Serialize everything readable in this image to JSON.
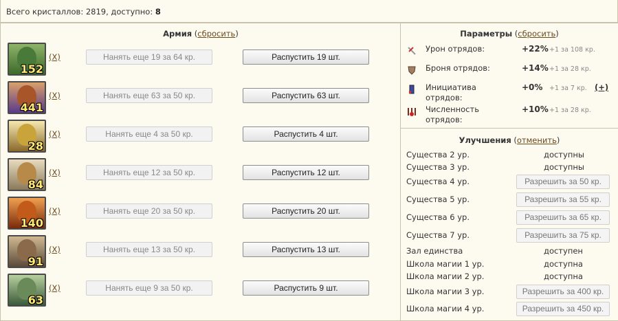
{
  "header": {
    "crystals_label": "Всего кристаллов: 2819, доступно:",
    "available": "8"
  },
  "army": {
    "title": "Армия",
    "reset_open": " (",
    "reset_label": "сбросить",
    "reset_close": ")",
    "units": [
      {
        "count": "152",
        "x": "(X)",
        "hire": "Нанять еще 19 за 64 кр.",
        "dismiss": "Распустить 19 шт.",
        "color": "#4a7a3a"
      },
      {
        "count": "441",
        "x": "(X)",
        "hire": "Нанять еще 63 за 50 кр.",
        "dismiss": "Распустить 63 шт.",
        "color": "#a8552a"
      },
      {
        "count": "28",
        "x": "(X)",
        "hire": "Нанять еще 4 за 50 кр.",
        "dismiss": "Распустить 4 шт.",
        "color": "#c9a43a"
      },
      {
        "count": "84",
        "x": "(X)",
        "hire": "Нанять еще 12 за 50 кр.",
        "dismiss": "Распустить 12 шт.",
        "color": "#b88a4a"
      },
      {
        "count": "140",
        "x": "(X)",
        "hire": "Нанять еще 20 за 50 кр.",
        "dismiss": "Распустить 20 шт.",
        "color": "#c25a1a"
      },
      {
        "count": "91",
        "x": "(X)",
        "hire": "Нанять еще 13 за 50 кр.",
        "dismiss": "Распустить 13 шт.",
        "color": "#8a6a4a"
      },
      {
        "count": "63",
        "x": "(X)",
        "hire": "Нанять еще 9 за 50 кр.",
        "dismiss": "Распустить 9 шт.",
        "color": "#6a8a5a"
      }
    ]
  },
  "params": {
    "title": "Параметры",
    "reset_open": " (",
    "reset_label": "сбросить",
    "reset_close": ")",
    "items": [
      {
        "icon": "sword-icon",
        "label": "Урон отрядов:",
        "value": "+22%",
        "note": "+1 за 108 кр."
      },
      {
        "icon": "shield-icon",
        "label": "Броня отрядов:",
        "value": "+14%",
        "note": "+1 за 28 кр."
      },
      {
        "icon": "initiative-icon",
        "label": "Инициатива отрядов:",
        "value": "+0%",
        "note": "+1 за 7 кр.",
        "plus": "(+)"
      },
      {
        "icon": "troops-icon",
        "label": "Численность отрядов:",
        "value": "+10%",
        "note": "+1 за 28 кр."
      }
    ]
  },
  "upgrades": {
    "title": "Улучшения",
    "cancel_open": " (",
    "cancel_label": "отменить",
    "cancel_close": ")",
    "items": [
      {
        "name": "Существа 2 ур.",
        "status": "доступны"
      },
      {
        "name": "Существа 3 ур.",
        "status": "доступны"
      },
      {
        "name": "Существа 4 ур.",
        "button": "Разрешить за 50 кр."
      },
      {
        "name": "Существа 5 ур.",
        "button": "Разрешить за 55 кр."
      },
      {
        "name": "Существа 6 ур.",
        "button": "Разрешить за 65 кр."
      },
      {
        "name": "Существа 7 ур.",
        "button": "Разрешить за 75 кр."
      },
      {
        "name": "Зал единства",
        "status": "доступен"
      },
      {
        "name": "Школа магии 1 ур.",
        "status": "доступна"
      },
      {
        "name": "Школа магии 2 ур.",
        "status": "доступна"
      },
      {
        "name": "Школа магии 3 ур.",
        "button": "Разрешить за 400 кр."
      },
      {
        "name": "Школа магии 4 ур.",
        "button": "Разрешить за 450 кр."
      }
    ]
  }
}
